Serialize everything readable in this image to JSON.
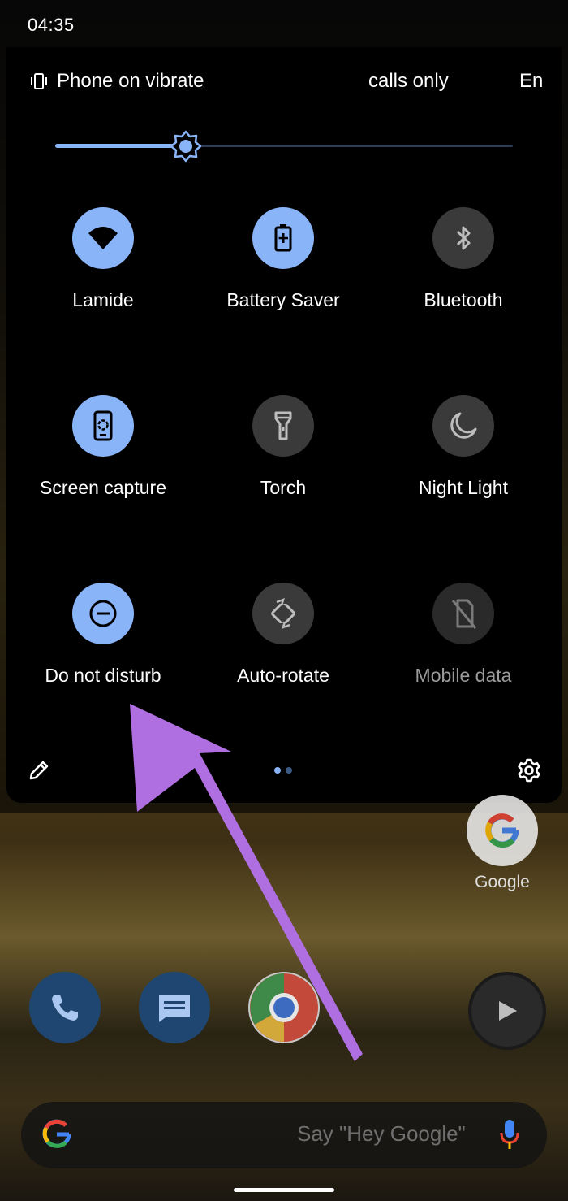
{
  "status_bar": {
    "time": "04:35"
  },
  "qs_header": {
    "vibrate_label": "Phone on vibrate",
    "calls_label": "​calls only",
    "en_label": "En"
  },
  "brightness": {
    "level": 0.285
  },
  "tiles": [
    {
      "label": "Lamide",
      "icon": "wifi-icon",
      "state": "on"
    },
    {
      "label": "Battery Saver",
      "icon": "battery-saver-icon",
      "state": "on"
    },
    {
      "label": "Bluetooth",
      "icon": "bluetooth-icon",
      "state": "off"
    },
    {
      "label": "Screen capture",
      "icon": "screen-capture-icon",
      "state": "on"
    },
    {
      "label": "Torch",
      "icon": "torch-icon",
      "state": "off"
    },
    {
      "label": "Night Light",
      "icon": "night-light-icon",
      "state": "off"
    },
    {
      "label": "Do not disturb",
      "icon": "dnd-icon",
      "state": "on"
    },
    {
      "label": "Auto-rotate",
      "icon": "auto-rotate-icon",
      "state": "off"
    },
    {
      "label": "Mobile data",
      "icon": "mobile-data-icon",
      "state": "unavailable"
    }
  ],
  "footer": {
    "page_count": 2,
    "current_page": 0
  },
  "home": {
    "google_app_label": "Google",
    "search_placeholder": "Say \"Hey Google\""
  },
  "colors": {
    "accent": "#8ab4f8",
    "tile_off": "#3a3a3a",
    "panel_bg": "#000000",
    "annotation_arrow": "#b06fe0"
  }
}
